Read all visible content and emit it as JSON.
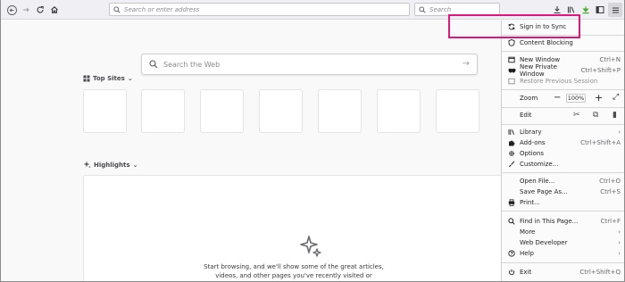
{
  "toolbar": {
    "address_placeholder": "Search or enter address",
    "search_placeholder": "Search"
  },
  "newtab": {
    "web_search_placeholder": "Search the Web",
    "top_sites_label": "Top Sites",
    "highlights_label": "Highlights",
    "highlights_text_line1": "Start browsing, and we'll show some of the great articles,",
    "highlights_text_line2": "videos, and other pages you've recently visited or"
  },
  "menu": {
    "sync": "Sign in to Sync",
    "content_blocking": "Content Blocking",
    "new_window": "New Window",
    "new_window_sc": "Ctrl+N",
    "new_private_window": "New Private Window",
    "new_private_window_sc": "Ctrl+Shift+P",
    "restore_session": "Restore Previous Session",
    "zoom": "Zoom",
    "zoom_value": "100%",
    "edit": "Edit",
    "library": "Library",
    "addons": "Add-ons",
    "addons_sc": "Ctrl+Shift+A",
    "options": "Options",
    "customize": "Customize...",
    "open_file": "Open File...",
    "open_file_sc": "Ctrl+O",
    "save_page": "Save Page As...",
    "save_page_sc": "Ctrl+S",
    "print": "Print...",
    "find": "Find in This Page...",
    "find_sc": "Ctrl+F",
    "more": "More",
    "web_developer": "Web Developer",
    "help": "Help",
    "exit": "Exit",
    "exit_sc": "Ctrl+Shift+Q"
  },
  "colors": {
    "annotation": "#e0157d",
    "toolbar_bg": "#f0f0f4",
    "download_icon": "#3fae29"
  }
}
